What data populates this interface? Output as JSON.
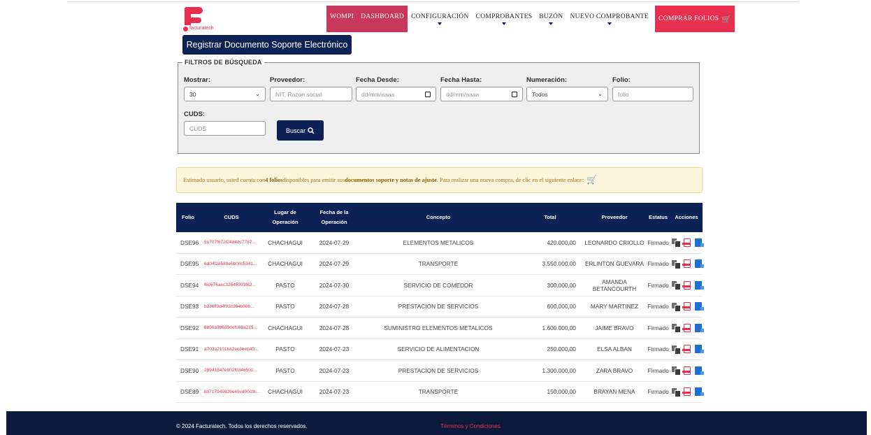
{
  "brand": {
    "name": "facturatech",
    "color": "#e8304e",
    "navy": "#0c2255"
  },
  "nav": [
    {
      "label": "WOMPI",
      "style": "dark",
      "caret": false
    },
    {
      "label": "DASHBOARD",
      "style": "dark",
      "caret": false
    },
    {
      "label": "CONFIGURACIÓN",
      "style": "plain",
      "caret": true
    },
    {
      "label": "COMPROBANTES",
      "style": "plain",
      "caret": true
    },
    {
      "label": "BUZÓN",
      "style": "plain",
      "caret": true
    },
    {
      "label": "NUEVO COMPROBANTE",
      "style": "plain",
      "caret": true
    },
    {
      "label": "COMPRAR FOLIOS",
      "style": "red",
      "caret": false
    }
  ],
  "register_button": "Registrar Documento Soporte Electrónico",
  "filters": {
    "legend": "FILTROS DE BÚSQUEDA",
    "mostrar": {
      "label": "Mostrar:",
      "value": "30"
    },
    "proveedor": {
      "label": "Proveedor:",
      "placeholder": "NIT, Razon social"
    },
    "fecha_desde": {
      "label": "Fecha Desde:",
      "placeholder": "dd/mm/aaaa"
    },
    "fecha_hasta": {
      "label": "Fecha Hasta:",
      "placeholder": "dd/mm/aaaa"
    },
    "numeracion": {
      "label": "Numeración:",
      "value": "Todos"
    },
    "folio": {
      "label": "Folio:",
      "placeholder": "folio"
    },
    "cuds": {
      "label": "CUDS:",
      "placeholder": "CUDS"
    },
    "search_button": "Buscar"
  },
  "alert": {
    "p1": "Estimado usuario, usted cuenta con ",
    "b1": "4 folios",
    "p2": " disponibles para emitir sus ",
    "b2": "documentos soporte y notas de ajuste",
    "p3": ". Para realizar una nueva compra, de clic en el siguiente enlace:"
  },
  "table": {
    "headers": [
      "Folio",
      "CUDS",
      "Lugar de Operación",
      "Fecha de la Operación",
      "Concepto",
      "Total",
      "Proveedor",
      "Estatus",
      "Acciones"
    ],
    "rows": [
      [
        "DSE96",
        "51707f672f24d4dc7787...",
        "CHACHAGUI",
        "2024-07-29",
        "ELEMENTOS METALICOS",
        "420.000,00",
        "LEONARDO CRIOLLO",
        "Firmado"
      ],
      [
        "DSE95",
        "6d04f2e589e6b00c5341...",
        "CHACHAGUI",
        "2024-07-29",
        "TRANSPORTE",
        "3.550.000,00",
        "ERLINTON GUEVARA",
        "Firmado"
      ],
      [
        "DSE94",
        "f6e676aec32545993f62...",
        "PASTO",
        "2024-07-30",
        "SERVICIO DE COMEDOR",
        "300.000,00",
        "AMANDA BETANCOURTH",
        "Firmado"
      ],
      [
        "DSE93",
        "b236ff3d4f93c364b08b...",
        "PASTO",
        "2024-07-28",
        "PRESTACION DE SERVICIOS",
        "600.000,00",
        "MARY MARTINEZ",
        "Firmado"
      ],
      [
        "DSE92",
        "6b96a598d9def168a215...",
        "CHACHAGUI",
        "2024-07-28",
        "SUMINISTRO ELEMENTOS METALICOS",
        "1.600.000,00",
        "JAIME BRAVO",
        "Firmado"
      ],
      [
        "DSE91",
        "a703a2101ba2ec3eeb40...",
        "PASTO",
        "2024-07-23",
        "SERVICIO DE ALIMENTACION",
        "250.000,00",
        "ELSA ALBAN",
        "Firmado"
      ],
      [
        "DSE90",
        "29941547e902f0346502...",
        "PASTO",
        "2024-07-23",
        "PRESTACION DE SERVICIOS",
        "1.300.000,00",
        "ZARA BRAVO",
        "Firmado"
      ],
      [
        "DSE89",
        "b0717945926e49cd00cf8...",
        "CHACHAGUI",
        "2024-07-23",
        "TRANSPORTE",
        "150.000,00",
        "BRAYAN MENA",
        "Firmado"
      ]
    ]
  },
  "footer": {
    "copyright": "© 2024 Facturatech. Todos los derechos reservados.",
    "terms": "Términos y Condiciones"
  }
}
